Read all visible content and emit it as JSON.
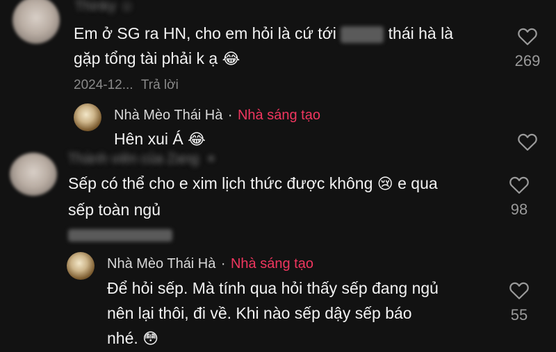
{
  "comments": [
    {
      "id": "c1",
      "text_line1_a": "Em ở SG ra HN, cho em hỏi là cứ tới",
      "text_line1_b": "thái hà là",
      "text_line2": "gặp tổng tài phải k ạ",
      "emoji": "😂",
      "date": "2024-12...",
      "reply_label": "Trả lời",
      "likes": "269"
    },
    {
      "id": "r1",
      "author": "Nhà Mèo Thái Hà",
      "separator": "·",
      "badge": "Nhà sáng tạo",
      "text": "Hên xui Á",
      "emoji": "😂"
    },
    {
      "id": "c2",
      "text_line1": "Sếp có thể cho e xim lịch thức được không",
      "emoji": "😢",
      "text_line1_b": "e qua",
      "text_line2": "sếp toàn ngủ",
      "likes": "98"
    },
    {
      "id": "r2",
      "author": "Nhà Mèo Thái Hà",
      "separator": "·",
      "badge": "Nhà sáng tạo",
      "text_line1": "Để hỏi sếp. Mà tính qua hỏi thấy sếp đang ngủ",
      "text_line2": "nên lại thôi, đi về. Khi nào sếp dậy sếp báo",
      "text_line3": "nhé.",
      "emoji": "😳",
      "likes": "55"
    }
  ],
  "colors": {
    "background": "#121212",
    "creator_badge": "#f0365f",
    "muted": "#8a8a8a"
  },
  "icons": [
    "heart-outline-icon",
    "avatar"
  ]
}
